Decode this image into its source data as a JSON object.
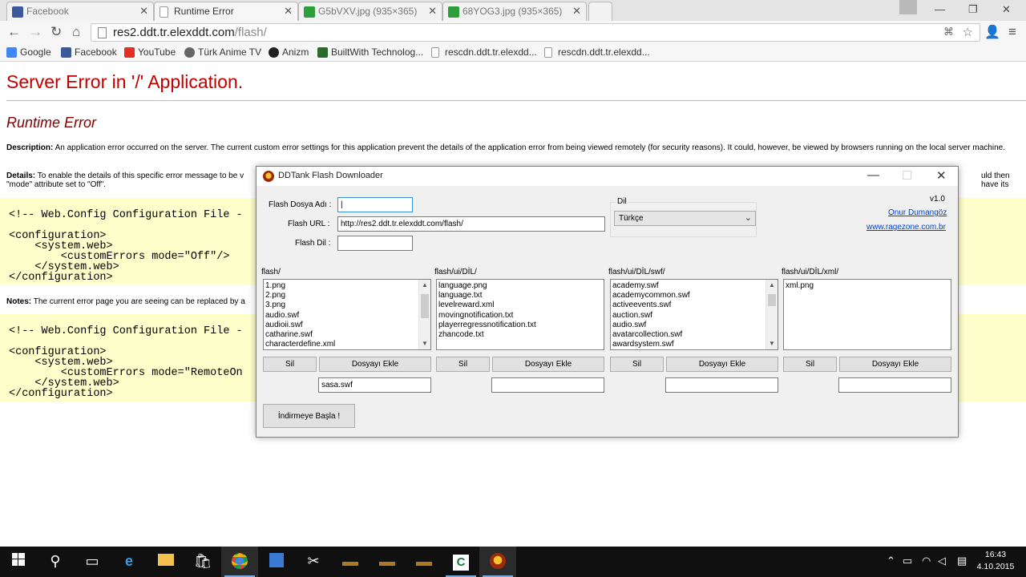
{
  "browser": {
    "tabs": [
      {
        "title": "Facebook",
        "icon": "facebook-icon",
        "color": "#3b5998"
      },
      {
        "title": "Runtime Error",
        "icon": "page-icon",
        "color": "#ffffff"
      },
      {
        "title": "G5bVXV.jpg (935×365)",
        "icon": "image-icon",
        "color": "#2e9e3a"
      },
      {
        "title": "68YOG3.jpg (935×365)",
        "icon": "image-icon",
        "color": "#2e9e3a"
      }
    ],
    "url_main": "res2.ddt.tr.elexddt.com",
    "url_path": "/flash/",
    "bookmarks": [
      {
        "label": "Google",
        "icon": "google-icon",
        "color": "#4285f4"
      },
      {
        "label": "Facebook",
        "icon": "facebook-icon",
        "color": "#3b5998"
      },
      {
        "label": "YouTube",
        "icon": "youtube-icon",
        "color": "#e52d27"
      },
      {
        "label": "Türk Anime TV",
        "icon": "anime-icon",
        "color": "#666666"
      },
      {
        "label": "Anizm",
        "icon": "anizm-icon",
        "color": "#222222"
      },
      {
        "label": "BuiltWith Technolog...",
        "icon": "builtwith-icon",
        "color": "#2a6a2a"
      },
      {
        "label": "rescdn.ddt.tr.elexdd...",
        "icon": "page-icon",
        "color": "#ffffff"
      },
      {
        "label": "rescdn.ddt.tr.elexdd...",
        "icon": "page-icon",
        "color": "#ffffff"
      }
    ]
  },
  "error_page": {
    "title": "Server Error in '/' Application.",
    "subtitle": "Runtime Error",
    "description_label": "Description:",
    "description_text": " An application error occurred on the server. The current custom error settings for this application prevent the details of the application error from being viewed remotely (for security reasons). It could, however, be viewed by browsers running on the local server machine.",
    "details_label": "Details:",
    "details_text": " To enable the details of this specific error message to be v",
    "details_tail": "uld then have its",
    "details_line2": "\"mode\" attribute set to \"Off\".",
    "code1": "<!-- Web.Config Configuration File -\n\n<configuration>\n    <system.web>\n        <customErrors mode=\"Off\"/>\n    </system.web>\n</configuration>",
    "notes_label": "Notes:",
    "notes_text": " The current error page you are seeing can be replaced by a",
    "code2": "<!-- Web.Config Configuration File -\n\n<configuration>\n    <system.web>\n        <customErrors mode=\"RemoteOn\n    </system.web>\n</configuration>"
  },
  "dialog": {
    "title": "DDTank Flash Downloader",
    "flash_file_label": "Flash Dosya Adı :",
    "flash_file_value": "|",
    "flash_url_label": "Flash URL :",
    "flash_url_value": "http://res2.ddt.tr.elexddt.com/flash/",
    "flash_lang_label": "Flash Dil :",
    "flash_lang_value": "",
    "lang_group_label": "Dil",
    "lang_selected": "Türkçe",
    "version": "v1.0",
    "author": "Onur Dumangöz",
    "website": "www.ragezone.com.br",
    "columns": [
      {
        "header": "flash/",
        "items": [
          "1.png",
          "2.png",
          "3.png",
          "audio.swf",
          "audioii.swf",
          "catharine.swf",
          "characterdefine.xml"
        ],
        "scroll": true,
        "thumb_pct": 0.3,
        "input": "sasa.swf"
      },
      {
        "header": "flash/ui/DİL/",
        "items": [
          "language.png",
          "language.txt",
          "levelreward.xml",
          "movingnotification.txt",
          "playerregressnotification.txt",
          "zhancode.txt"
        ],
        "scroll": false,
        "input": ""
      },
      {
        "header": "flash/ui/DİL/swf/",
        "items": [
          "academy.swf",
          "academycommon.swf",
          "activeevents.swf",
          "auction.swf",
          "audio.swf",
          "avatarcollection.swf",
          "awardsystem.swf"
        ],
        "scroll": true,
        "thumb_pct": 0.15,
        "input": ""
      },
      {
        "header": "flash/ui/DİL/xml/",
        "items": [
          "xml.png"
        ],
        "scroll": false,
        "input": ""
      }
    ],
    "delete_label": "Sil",
    "add_file_label": "Dosyayı Ekle",
    "start_label": "İndirmeye Başla !"
  },
  "taskbar": {
    "time": "16:43",
    "date": "4.10.2015"
  }
}
